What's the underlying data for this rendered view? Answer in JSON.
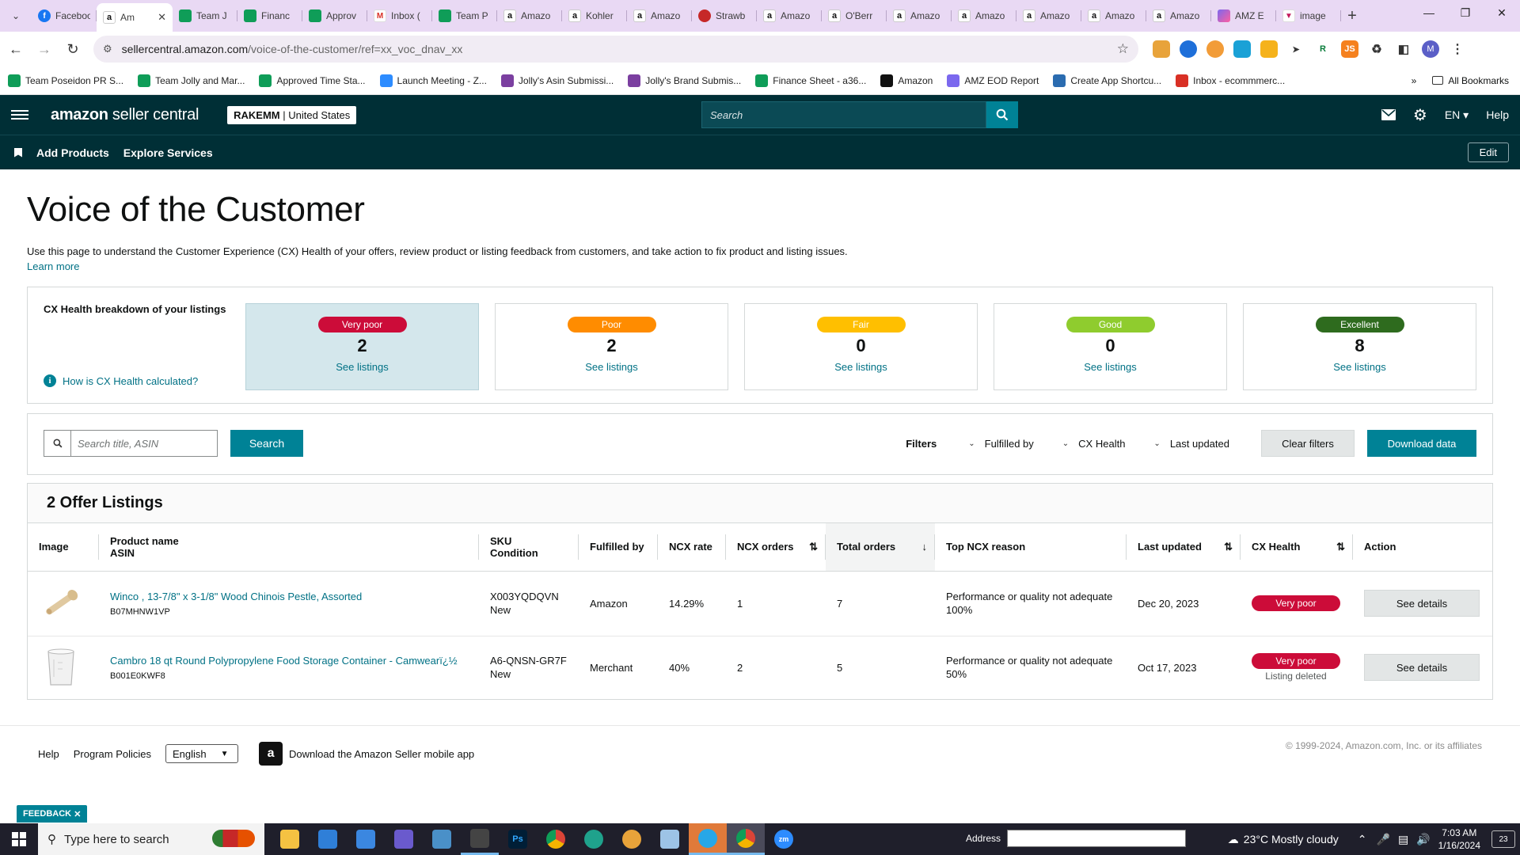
{
  "browser": {
    "tabs": [
      {
        "label": "Facebook",
        "favicon": "facebook-icon",
        "active": false
      },
      {
        "label": "Am",
        "favicon": "amazon-icon",
        "active": true
      },
      {
        "label": "Team J",
        "favicon": "sheets-icon",
        "active": false
      },
      {
        "label": "Financ",
        "favicon": "sheets-icon",
        "active": false
      },
      {
        "label": "Approv",
        "favicon": "sheets-icon",
        "active": false
      },
      {
        "label": "Inbox (",
        "favicon": "gmail-icon",
        "active": false
      },
      {
        "label": "Team P",
        "favicon": "sheets-icon",
        "active": false
      },
      {
        "label": "Amazo",
        "favicon": "amazon-icon",
        "active": false
      },
      {
        "label": "Kohler",
        "favicon": "amazon-icon",
        "active": false
      },
      {
        "label": "Amazo",
        "favicon": "amazon-icon",
        "active": false
      },
      {
        "label": "Strawb",
        "favicon": "strawberry-icon",
        "active": false
      },
      {
        "label": "Amazo",
        "favicon": "amazon-icon",
        "active": false
      },
      {
        "label": "O'Berr",
        "favicon": "amazon-icon",
        "active": false
      },
      {
        "label": "Amazo",
        "favicon": "amazon-icon",
        "active": false
      },
      {
        "label": "Amazo",
        "favicon": "amazon-icon",
        "active": false
      },
      {
        "label": "Amazo",
        "favicon": "amazon-icon",
        "active": false
      },
      {
        "label": "Amazo",
        "favicon": "amazon-icon",
        "active": false
      },
      {
        "label": "Amazo",
        "favicon": "amazon-icon",
        "active": false
      },
      {
        "label": "AMZ E",
        "favicon": "clickup-icon",
        "active": false
      },
      {
        "label": "image",
        "favicon": "image-icon",
        "active": false
      }
    ],
    "url_host": "sellercentral.amazon.com",
    "url_path": "/voice-of-the-customer/ref=xx_voc_dnav_xx",
    "bookmarks": [
      {
        "label": "Team Poseidon PR S...",
        "icon": "sheets-icon",
        "color": "#0f9d58"
      },
      {
        "label": "Team Jolly and Mar...",
        "icon": "sheets-icon",
        "color": "#0f9d58"
      },
      {
        "label": "Approved Time Sta...",
        "icon": "sheets-icon",
        "color": "#0f9d58"
      },
      {
        "label": "Launch Meeting - Z...",
        "icon": "zoom-icon",
        "color": "#2d8cff"
      },
      {
        "label": "Jolly's Asin Submissi...",
        "icon": "form-icon",
        "color": "#7b3fa0"
      },
      {
        "label": "Jolly's Brand Submis...",
        "icon": "form-icon",
        "color": "#7b3fa0"
      },
      {
        "label": "Finance Sheet - a36...",
        "icon": "sheets-icon",
        "color": "#0f9d58"
      },
      {
        "label": "Amazon",
        "icon": "amazon-icon",
        "color": "#111111"
      },
      {
        "label": "AMZ EOD Report",
        "icon": "clickup-icon",
        "color": "#7b68ee"
      },
      {
        "label": "Create App Shortcu...",
        "icon": "shortcut-icon",
        "color": "#2b6cb0"
      },
      {
        "label": "Inbox - ecommmerc...",
        "icon": "gmail-icon",
        "color": "#d93025"
      }
    ],
    "all_bookmarks": "All Bookmarks",
    "profile_initial": "M"
  },
  "header": {
    "logo_bold": "amazon",
    "logo_rest": " seller central",
    "store_name": "RAKEMM",
    "store_market": "United States",
    "search_placeholder": "Search",
    "lang": "EN",
    "help": "Help"
  },
  "subnav": {
    "links": [
      "Add Products",
      "Explore Services"
    ],
    "edit": "Edit"
  },
  "page": {
    "title": "Voice of the Customer",
    "intro": "Use this page to understand the Customer Experience (CX) Health of your offers, review product or listing feedback from customers, and take action to fix product and listing issues.",
    "learn_more": "Learn more"
  },
  "cx": {
    "title": "CX Health breakdown of your listings",
    "how_link": "How is CX Health calculated?",
    "cards": [
      {
        "label": "Very poor",
        "count": "2",
        "link": "See listings",
        "color": "#cc0c39",
        "selected": true
      },
      {
        "label": "Poor",
        "count": "2",
        "link": "See listings",
        "color": "#ff8c00",
        "selected": false
      },
      {
        "label": "Fair",
        "count": "0",
        "link": "See listings",
        "color": "#ffbf00",
        "selected": false
      },
      {
        "label": "Good",
        "count": "0",
        "link": "See listings",
        "color": "#8fcc2e",
        "selected": false
      },
      {
        "label": "Excellent",
        "count": "8",
        "link": "See listings",
        "color": "#2e6b1e",
        "selected": false
      }
    ]
  },
  "filters": {
    "search_placeholder": "Search title, ASIN",
    "search_button": "Search",
    "label": "Filters",
    "fulfilled_by": "Fulfilled by",
    "cx_health": "CX Health",
    "last_updated": "Last updated",
    "clear": "Clear filters",
    "download": "Download data"
  },
  "listings": {
    "heading": "2 Offer Listings",
    "columns": {
      "image": "Image",
      "product_name": "Product name",
      "asin": "ASIN",
      "sku": "SKU",
      "condition": "Condition",
      "fulfilled_by": "Fulfilled by",
      "ncx_rate": "NCX rate",
      "ncx_orders": "NCX orders",
      "total_orders": "Total orders",
      "top_reason": "Top NCX reason",
      "last_updated": "Last updated",
      "cx_health": "CX Health",
      "action": "Action"
    },
    "rows": [
      {
        "name": "Winco , 13-7/8\" x 3-1/8\" Wood Chinois Pestle, Assorted",
        "asin": "B07MHNW1VP",
        "sku": "X003YQDQVN",
        "condition": "New",
        "fulfilled_by": "Amazon",
        "ncx_rate": "14.29%",
        "ncx_orders": "1",
        "total_orders": "7",
        "reason": "Performance or quality not adequate",
        "reason_pct": "100%",
        "last_updated": "Dec 20, 2023",
        "health": "Very poor",
        "health_note": "",
        "action": "See details",
        "thumb": "pestle"
      },
      {
        "name": "Cambro 18 qt Round Polypropylene Food Storage Container - Camwearï¿½",
        "asin": "B001E0KWF8",
        "sku": "A6-QNSN-GR7F",
        "condition": "New",
        "fulfilled_by": "Merchant",
        "ncx_rate": "40%",
        "ncx_orders": "2",
        "total_orders": "5",
        "reason": "Performance or quality not adequate",
        "reason_pct": "50%",
        "last_updated": "Oct 17, 2023",
        "health": "Very poor",
        "health_note": "Listing deleted",
        "action": "See details",
        "thumb": "container"
      }
    ]
  },
  "footer": {
    "help": "Help",
    "policies": "Program Policies",
    "language": "English",
    "app": "Download the Amazon Seller mobile app",
    "copyright": "© 1999-2024, Amazon.com, Inc. or its affiliates",
    "feedback": "FEEDBACK"
  },
  "taskbar": {
    "search": "Type here to search",
    "address_label": "Address",
    "weather": "23°C  Mostly cloudy",
    "time": "7:03 AM",
    "date": "1/16/2024",
    "notifications": "23"
  }
}
